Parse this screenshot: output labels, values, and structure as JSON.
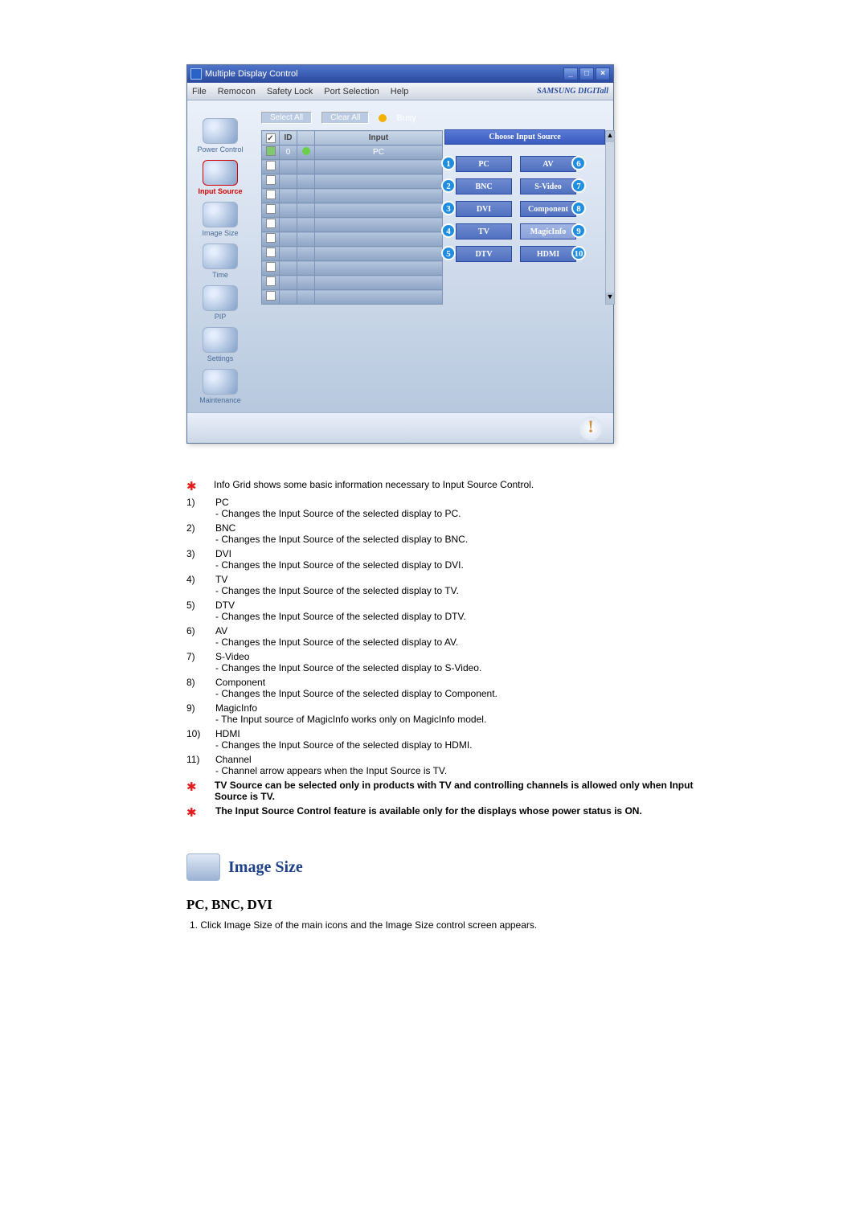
{
  "titlebar": {
    "caption": "Multiple Display Control"
  },
  "menubar": {
    "items": [
      "File",
      "Remocon",
      "Safety Lock",
      "Port Selection",
      "Help"
    ],
    "brand": "SAMSUNG DIGITall"
  },
  "actions": {
    "select_all": "Select All",
    "clear_all": "Clear All",
    "busy": "Busy"
  },
  "grid": {
    "headers": {
      "c0": "☑",
      "c1": "ID",
      "c2": "",
      "c3": "Input"
    },
    "first_row": {
      "id": "0",
      "input": "PC"
    }
  },
  "sidebar": {
    "items": [
      {
        "label": "Power Control"
      },
      {
        "label": "Input Source"
      },
      {
        "label": "Image Size"
      },
      {
        "label": "Time"
      },
      {
        "label": "PIP"
      },
      {
        "label": "Settings"
      },
      {
        "label": "Maintenance"
      }
    ]
  },
  "panel": {
    "title": "Choose Input Source",
    "left": [
      {
        "n": "1",
        "label": "PC"
      },
      {
        "n": "2",
        "label": "BNC"
      },
      {
        "n": "3",
        "label": "DVI"
      },
      {
        "n": "4",
        "label": "TV"
      },
      {
        "n": "5",
        "label": "DTV"
      }
    ],
    "right": [
      {
        "n": "6",
        "label": "AV"
      },
      {
        "n": "7",
        "label": "S-Video"
      },
      {
        "n": "8",
        "label": "Component"
      },
      {
        "n": "9",
        "label": "MagicInfo"
      },
      {
        "n": "10",
        "label": "HDMI"
      }
    ]
  },
  "doc": {
    "intro_star": "Info Grid shows some basic information necessary to Input Source Control.",
    "items": [
      {
        "n": "1)",
        "title": "PC",
        "desc": "- Changes the Input Source of the selected display to PC."
      },
      {
        "n": "2)",
        "title": "BNC",
        "desc": "- Changes the Input Source of the selected display to BNC."
      },
      {
        "n": "3)",
        "title": "DVI",
        "desc": "- Changes the Input Source of the selected display to DVI."
      },
      {
        "n": "4)",
        "title": "TV",
        "desc": "- Changes the Input Source of the selected display to TV."
      },
      {
        "n": "5)",
        "title": "DTV",
        "desc": "- Changes the Input Source of the selected display to DTV."
      },
      {
        "n": "6)",
        "title": "AV",
        "desc": "- Changes the Input Source of the selected display to AV."
      },
      {
        "n": "7)",
        "title": "S-Video",
        "desc": "- Changes the Input Source of the selected display to S-Video."
      },
      {
        "n": "8)",
        "title": "Component",
        "desc": "- Changes the Input Source of the selected display to Component."
      },
      {
        "n": "9)",
        "title": "MagicInfo",
        "desc": "- The Input source of MagicInfo works only on MagicInfo model."
      },
      {
        "n": "10)",
        "title": "HDMI",
        "desc": "- Changes the Input Source of the selected display to HDMI."
      },
      {
        "n": "11)",
        "title": "Channel",
        "desc": "- Channel arrow appears when the Input Source is TV."
      }
    ],
    "note1": "TV Source can be selected only in products with TV and controlling channels is allowed only when Input Source is TV.",
    "note2": "The Input Source Control feature is available only for the displays whose power status is ON.",
    "section_title": "Image Size",
    "subhead": "PC, BNC, DVI",
    "step1": "1. Click Image Size of the main icons and the Image Size control screen appears."
  }
}
